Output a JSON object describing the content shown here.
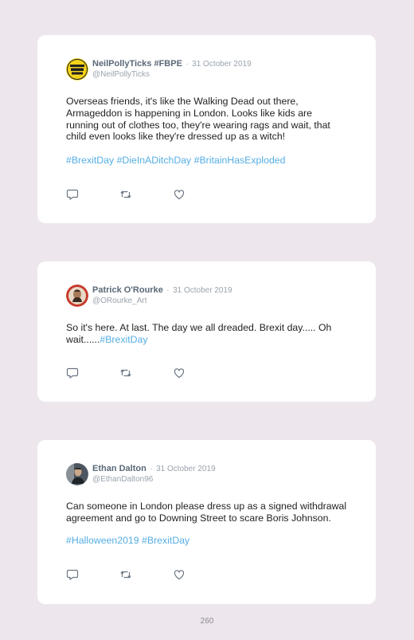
{
  "page_number": "260",
  "colors": {
    "page_background": "#ede6ec",
    "card_background": "#ffffff",
    "hashtag": "#55aee3",
    "name": "#5a6877",
    "muted": "#9aa3ad"
  },
  "tweets": [
    {
      "author": {
        "name": "NeilPollyTicks #FBPE",
        "handle": "@NeilPollyTicks",
        "avatar_icon": "bollocks-to-brexit-badge"
      },
      "separator": "·",
      "date": "31 October 2019",
      "text": "Overseas friends, it's like the Walking Dead out there, Armageddon is happening in London. Looks like kids are running out of clothes too, they're wearing rags and wait, that child even looks like they're dressed up as a witch!",
      "hashtags": [
        "#BrexitDay",
        "#DieInADitchDay",
        "#BritainHasExploded"
      ]
    },
    {
      "author": {
        "name": "Patrick O'Rourke",
        "handle": "@ORourke_Art",
        "avatar_icon": "portrait-photo"
      },
      "separator": "·",
      "date": "31 October 2019",
      "text": "So it's here. At last. The day we all dreaded. Brexit day..... Oh wait......",
      "hashtags": [
        "#BrexitDay"
      ]
    },
    {
      "author": {
        "name": "Ethan Dalton",
        "handle": "@EthanDalton96",
        "avatar_icon": "portrait-photo"
      },
      "separator": "·",
      "date": "31 October 2019",
      "text": "Can someone in London please dress up as a signed withdrawal agreement and go to Downing Street to scare Boris Johnson.",
      "hashtags": [
        "#Halloween2019",
        "#BrexitDay"
      ]
    }
  ],
  "actions": {
    "icons": [
      "reply-icon",
      "retweet-icon",
      "like-icon"
    ]
  }
}
